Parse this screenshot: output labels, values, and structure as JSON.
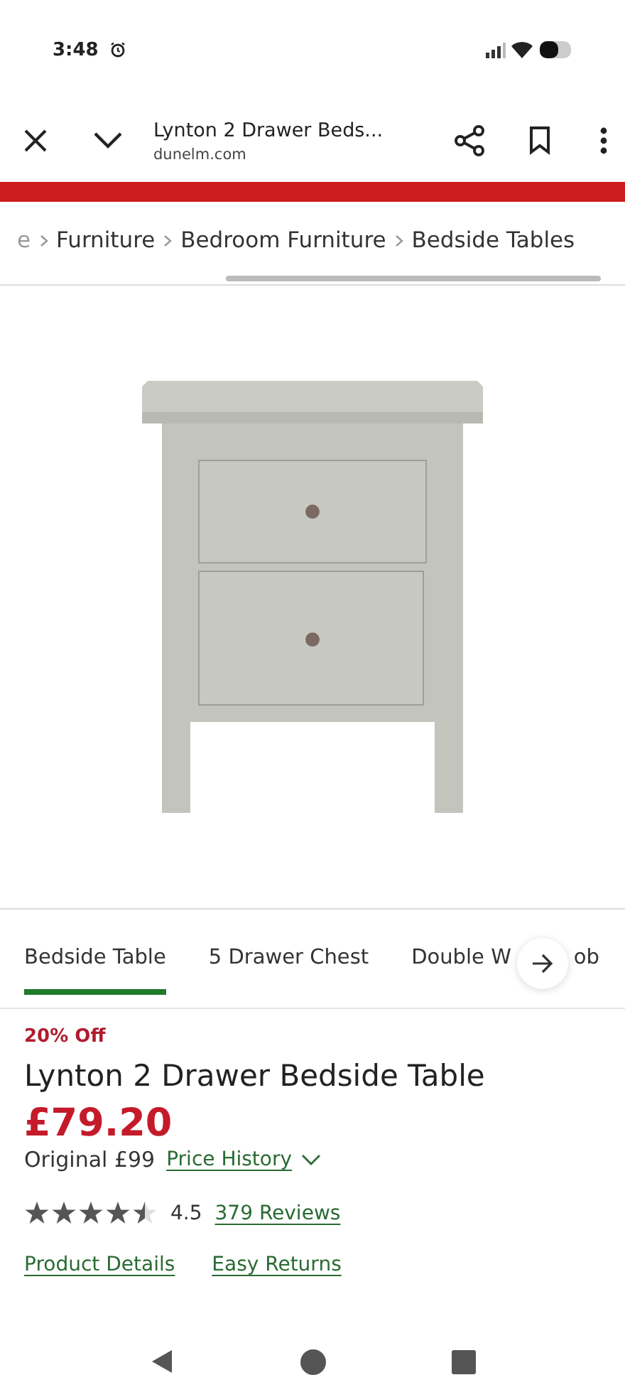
{
  "status_bar": {
    "time": "3:48"
  },
  "browser": {
    "title": "Lynton 2 Drawer Beds...",
    "domain": "dunelm.com"
  },
  "breadcrumbs": [
    "e",
    "Furniture",
    "Bedroom Furniture",
    "Bedside Tables"
  ],
  "tabs": [
    {
      "label": "Bedside Table",
      "selected": true
    },
    {
      "label": "5 Drawer Chest",
      "selected": false
    },
    {
      "label": "Double W",
      "tail": "ob",
      "selected": false
    }
  ],
  "product": {
    "badge": "20% Off",
    "title": "Lynton 2 Drawer Bedside Table",
    "price": "£79.20",
    "original": "Original £99",
    "price_history": "Price History",
    "stars": 4.5,
    "rating": "4.5",
    "reviews": "379 Reviews",
    "links": [
      "Product Details",
      "Easy Returns"
    ]
  }
}
